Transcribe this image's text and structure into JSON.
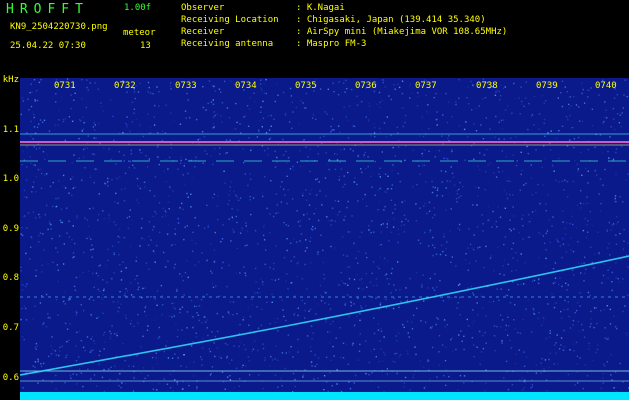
{
  "header": {
    "logo": "HROFFT",
    "version": "1.00f",
    "filename": "KN9_2504220730.png",
    "datetime": "25.04.22 07:30",
    "meteor_label": "meteor",
    "meteor_count": "13",
    "info": [
      {
        "label": "Observer",
        "value": ": K.Nagai"
      },
      {
        "label": "Receiving Location",
        "value": ": Chigasaki, Japan (139.414 35.340)"
      },
      {
        "label": "Receiver",
        "value": ": AirSpy mini (Miakejima VOR 108.65MHz)"
      },
      {
        "label": "Receiving antenna",
        "value": ": Maspro FM-3"
      }
    ]
  },
  "spectrogram": {
    "y_unit": "kHz",
    "y_ticks": [
      "1.1",
      "1.0",
      "0.9",
      "0.8",
      "0.7",
      "0.6"
    ],
    "time_ticks": [
      "0731",
      "0732",
      "0733",
      "0734",
      "0735",
      "0736",
      "0737",
      "0738",
      "0739",
      "0740"
    ],
    "colors": {
      "background": "#0b1a8a",
      "noise": "#3a6cff",
      "signal": "#32e0ff",
      "carrier": "#ff6ad5",
      "baseline": "#00e5ff"
    }
  }
}
